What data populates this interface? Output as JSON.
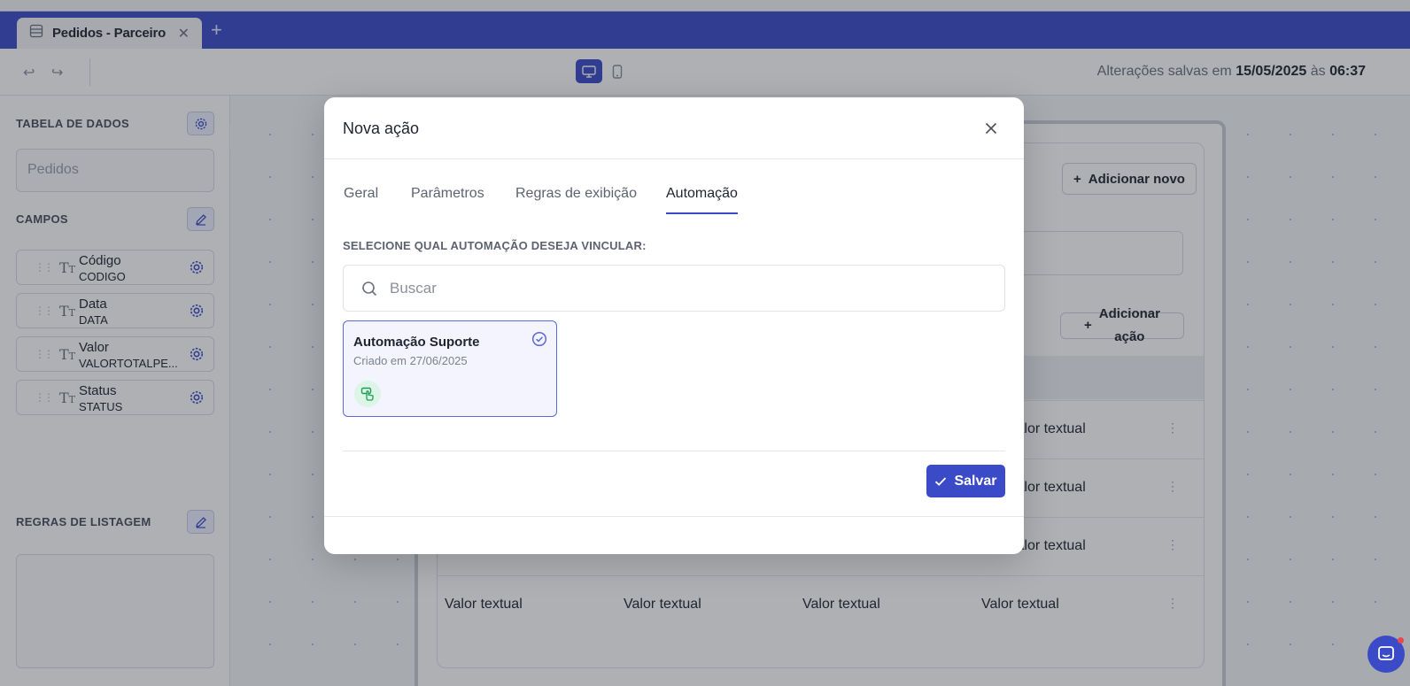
{
  "app": {
    "tab": {
      "label": "Pedidos - Parceiro"
    },
    "toolbar": {
      "saved_prefix": "Alterações salvas em",
      "saved_date": "15/05/2025",
      "saved_mid": "às",
      "saved_time": "06:37"
    },
    "sidebar": {
      "data_table_title": "TABELA DE DADOS",
      "data_table_value": "Pedidos",
      "fields_title": "CAMPOS",
      "fields": [
        {
          "name": "Código",
          "code": "CODIGO"
        },
        {
          "name": "Data",
          "code": "DATA"
        },
        {
          "name": "Valor",
          "code": "VALORTOTALPE..."
        },
        {
          "name": "Status",
          "code": "STATUS"
        }
      ],
      "listing_rules_title": "REGRAS DE LISTAGEM"
    },
    "canvas": {
      "add_new_label": "Adicionar novo",
      "add_action_line1": "Adicionar",
      "add_action_line2": "ação",
      "cell_text": "Valor textual"
    }
  },
  "modal": {
    "title": "Nova ação",
    "tabs": [
      {
        "label": "Geral"
      },
      {
        "label": "Parâmetros"
      },
      {
        "label": "Regras de exibição"
      },
      {
        "label": "Automação"
      }
    ],
    "active_tab": "Automação",
    "select_label": "SELECIONE QUAL AUTOMAÇÃO DESEJA VINCULAR:",
    "search": {
      "placeholder": "Buscar",
      "value": ""
    },
    "automations": [
      {
        "title": "Automação Suporte",
        "created": "Criado em 27/06/2025",
        "selected": true
      }
    ],
    "save_label": "Salvar"
  },
  "colors": {
    "accent": "#3b4bc8",
    "selected_border": "#5b68e0",
    "success_bg": "#dcf5e6",
    "success_icon": "#1f9d57"
  }
}
